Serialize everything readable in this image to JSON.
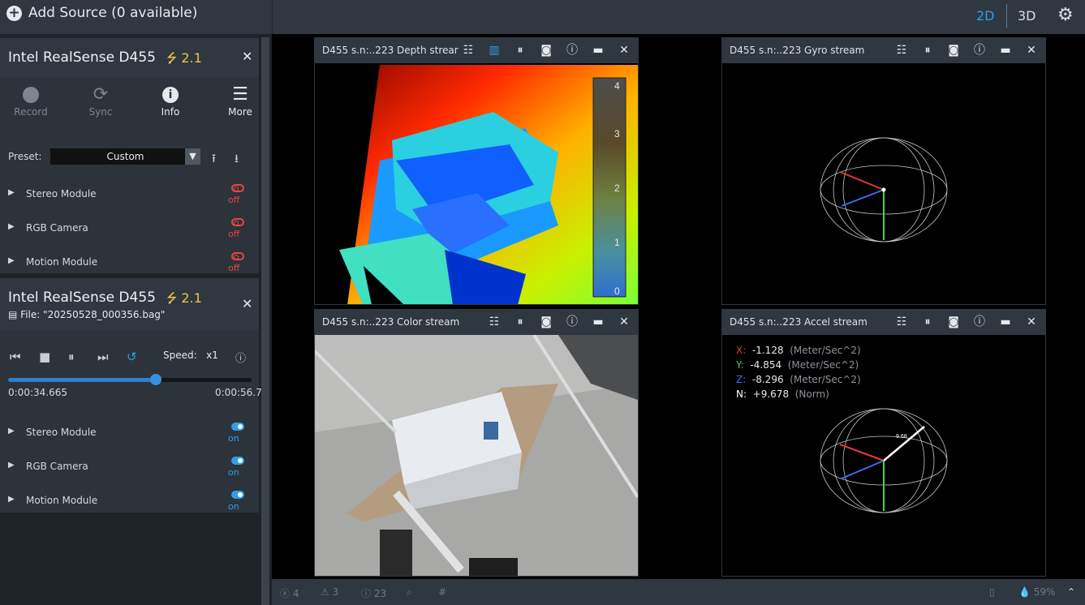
{
  "topbar": {
    "add_source": "Add Source (0 available)",
    "view_2d": "2D",
    "view_3d": "3D"
  },
  "device1": {
    "name": "Intel RealSense D455",
    "usb": "2.1",
    "toolbar": [
      "Record",
      "Sync",
      "Info",
      "More"
    ],
    "preset_label": "Preset:",
    "preset_value": "Custom",
    "modules": [
      {
        "name": "Stereo Module",
        "state": "off"
      },
      {
        "name": "RGB Camera",
        "state": "off"
      },
      {
        "name": "Motion Module",
        "state": "off"
      }
    ]
  },
  "device2": {
    "name": "Intel RealSense D455",
    "usb": "2.1",
    "file": "File: \"20250528_000356.bag\"",
    "speed_label": "Speed:",
    "speed_value": "x1",
    "progress_fraction": 0.606,
    "time_current": "0:00:34.665",
    "time_total": "0:00:56.7",
    "modules": [
      {
        "name": "Stereo Module",
        "state": "on"
      },
      {
        "name": "RGB Camera",
        "state": "on"
      },
      {
        "name": "Motion Module",
        "state": "on"
      }
    ]
  },
  "streams": {
    "depth": {
      "title": "D455 s.n:..223 Depth strear",
      "colorbar": [
        "4",
        "3",
        "2",
        "1",
        "0"
      ]
    },
    "gyro": {
      "title": "D455 s.n:..223 Gyro stream"
    },
    "color": {
      "title": "D455 s.n:..223 Color stream"
    },
    "accel": {
      "title": "D455 s.n:..223 Accel stream",
      "readout": [
        {
          "axis": "X:",
          "value": "-1.128",
          "unit": "(Meter/Sec^2)",
          "color": "#e53935"
        },
        {
          "axis": "Y:",
          "value": "-4.854",
          "unit": "(Meter/Sec^2)",
          "color": "#43d64a"
        },
        {
          "axis": "Z:",
          "value": "-8.296",
          "unit": "(Meter/Sec^2)",
          "color": "#3f6df0"
        },
        {
          "axis": "N:",
          "value": "+9.678",
          "unit": "(Norm)",
          "color": "#ffffff"
        }
      ],
      "norm_label": "9.68"
    }
  },
  "status": {
    "errors": "4",
    "warnings": "3",
    "info": "23",
    "zoom": "59%"
  }
}
